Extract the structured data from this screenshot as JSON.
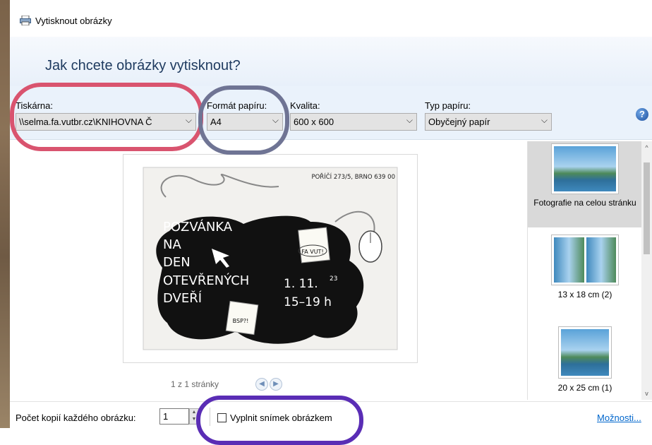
{
  "window": {
    "title": "Vytisknout obrázky"
  },
  "header": {
    "question": "Jak chcete obrázky vytisknout?"
  },
  "controls": {
    "printer_label": "Tiskárna:",
    "printer_value": "\\\\selma.fa.vutbr.cz\\KNIHOVNA Č",
    "paper_size_label": "Formát papíru:",
    "paper_size_value": "A4",
    "quality_label": "Kvalita:",
    "quality_value": "600 x 600",
    "paper_type_label": "Typ papíru:",
    "paper_type_value": "Obyčejný papír",
    "help": "?"
  },
  "preview": {
    "address": "POŘÍČÍ 273/5, BRNO 639 00",
    "headline": [
      "POZVÁNKA",
      "NA",
      "DEN",
      "OTEVŘENÝCH",
      "DVEŘÍ"
    ],
    "date": "1. 11.",
    "date_sup": "23",
    "time": "15–19 h",
    "sticker1": "FA VUT!",
    "sticker2": "BSP?!"
  },
  "pager": {
    "text": "1 z 1 stránky",
    "prev": "◀",
    "next": "▶"
  },
  "layouts": [
    {
      "label": "Fotografie na celou stránku",
      "selected": true
    },
    {
      "label": "13 x 18 cm (2)",
      "selected": false
    },
    {
      "label": "20 x 25 cm (1)",
      "selected": false
    }
  ],
  "footer": {
    "copies_label": "Počet kopií každého obrázku:",
    "copies_value": "1",
    "fit_label": "Vyplnit snímek obrázkem",
    "options_link": "Možnosti..."
  },
  "colors": {
    "ring_printer": "#d9546f",
    "ring_paper": "#6f7494",
    "ring_fit": "#5a2db5",
    "accent": "#0066cc"
  }
}
